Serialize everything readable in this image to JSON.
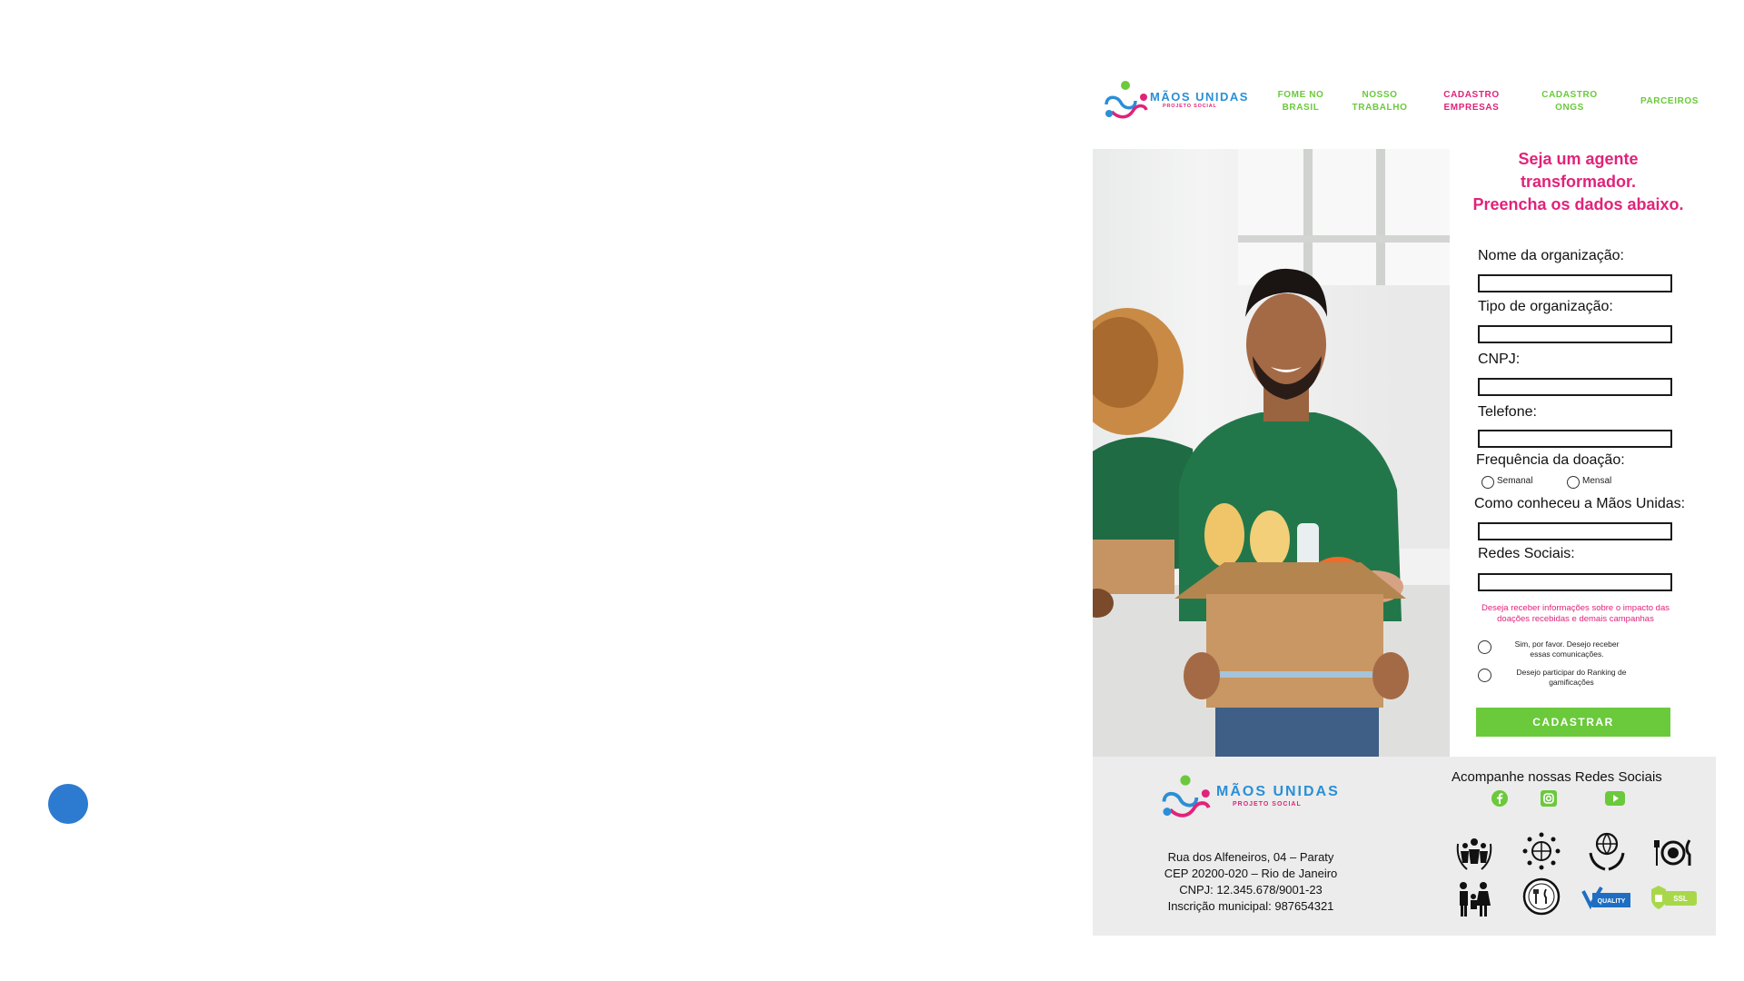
{
  "header": {
    "logo": {
      "name": "MÃOS UNIDAS",
      "tagline": "PROJETO SOCIAL"
    },
    "nav": [
      {
        "line1": "FOME NO",
        "line2": "BRASIL"
      },
      {
        "line1": "NOSSO",
        "line2": "TRABALHO"
      },
      {
        "line1": "CADASTRO",
        "line2": "EMPRESAS"
      },
      {
        "line1": "CADASTRO",
        "line2": "ONGS"
      },
      {
        "line1": "PARCEIROS",
        "line2": ""
      }
    ],
    "active_nav": "CADASTRO EMPRESAS"
  },
  "form": {
    "title_line1": "Seja um agente",
    "title_line2": "transformador.",
    "title_line3": "Preencha os dados abaixo.",
    "labels": {
      "org_name": "Nome da organização:",
      "org_type": "Tipo de organização:",
      "cnpj": "CNPJ:",
      "phone": "Telefone:",
      "frequency": "Frequência da doação:",
      "how_heard": "Como conheceu a Mãos Unidas:",
      "social": "Redes Sociais:"
    },
    "values": {
      "org_name": "",
      "org_type": "",
      "cnpj": "",
      "phone": "",
      "how_heard": "",
      "social": ""
    },
    "frequency_options": [
      "Semanal",
      "Mensal"
    ],
    "consent_question": "Deseja receber informações sobre o impacto das doações recebidas e demais campanhas",
    "consent_options": [
      {
        "line1": "Sim, por favor. Desejo receber",
        "line2": "essas comunicações."
      },
      {
        "line1": "Desejo participar do Ranking de",
        "line2": "gamificações"
      }
    ],
    "submit": "CADASTRAR"
  },
  "footer": {
    "logo": {
      "name": "MÃOS UNIDAS",
      "tagline": "PROJETO SOCIAL"
    },
    "address": [
      "Rua dos Alfeneiros, 04 – Paraty",
      "CEP 20200-020 – Rio de Janeiro",
      "CNPJ: 12.345.678/9001-23",
      "Inscrição municipal: 987654321"
    ],
    "social_title": "Acompanhe nossas Redes Sociais",
    "social_icons": [
      "facebook-icon",
      "instagram-icon",
      "youtube-icon"
    ],
    "badges": [
      "community-badge",
      "global-network-badge",
      "globe-hands-badge",
      "food-plate-badge",
      "family-badge",
      "food-seal-badge",
      "quality-badge",
      "ssl-badge"
    ],
    "ssl_text": "SSL",
    "quality_text": "QUALITY"
  },
  "colors": {
    "pink": "#e0237a",
    "green": "#6bc93c",
    "blue": "#2a8fd6",
    "dot_blue": "#2d7bd0",
    "footer_bg": "#ececec"
  }
}
